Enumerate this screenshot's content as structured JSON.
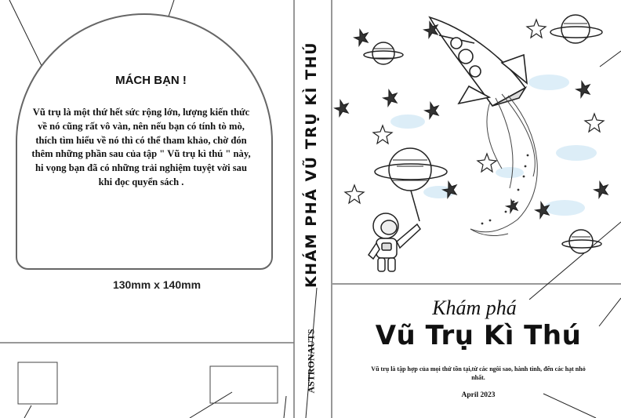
{
  "tip_box": {
    "title": "MÁCH BẠN !",
    "body": "Vũ trụ là một thứ hết sức rộng lớn, lượng kiến thức về nó cũng rất vô vàn, nên nếu bạn có tính tò mò, thích tìm hiểu về nó thì có thể tham khảo, chờ đón thêm những phần sau của tập \" Vũ trụ kì thú \" này, hi vọng bạn đã có những trải nghiệm tuyệt vời sau khi đọc quyển sách ."
  },
  "dimension_label": "130mm x 140mm",
  "spine": {
    "title": "KHÁM PHÁ VŨ TRỤ KÌ THÚ",
    "publisher": "ASTRONAUTS"
  },
  "front_cover": {
    "script_title": "Khám phá",
    "main_title": "Vũ Trụ Kì Thú",
    "description": "Vũ trụ là tập hợp của mọi thứ tồn tại,từ các ngôi sao, hành tinh, đến các hạt nhỏ nhất.",
    "date": "April 2023"
  },
  "colors": {
    "outline": "#666666",
    "ink": "#111111",
    "glow": "#d9ecf7"
  }
}
